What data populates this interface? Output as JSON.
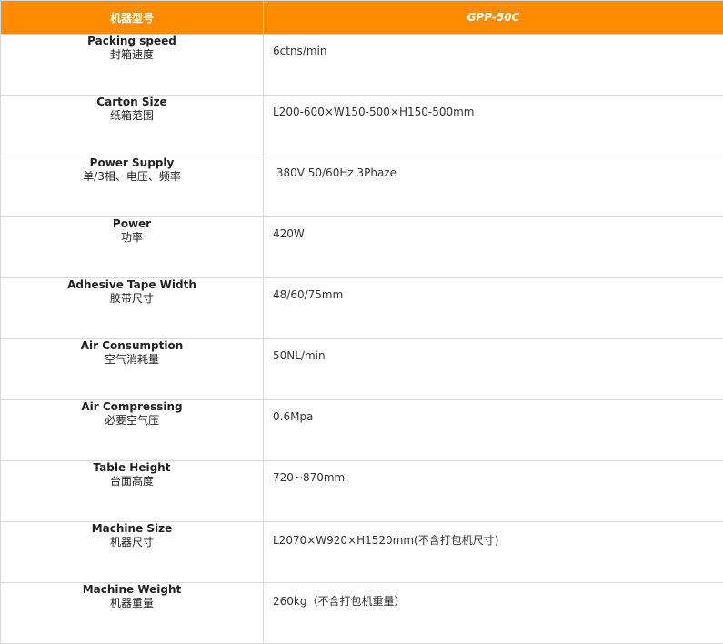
{
  "header": {
    "label_col": "机器型号",
    "model": "GPP-50C"
  },
  "rows": [
    {
      "en": "Packing speed",
      "zh": "封箱速度",
      "value": "6ctns/min"
    },
    {
      "en": "Carton Size",
      "zh": "纸箱范围",
      "value": "L200-600×W150-500×H150-500mm"
    },
    {
      "en": "Power Supply",
      "zh": "单/3相、电压、频率",
      "value": " 380V 50/60Hz 3Phaze"
    },
    {
      "en": "Power",
      "zh": "功率",
      "value": "420W"
    },
    {
      "en": "Adhesive Tape Width",
      "zh": "胶带尺寸",
      "value": "48/60/75mm"
    },
    {
      "en": "Air Consumption",
      "zh": "空气消耗量",
      "value": "50NL/min"
    },
    {
      "en": "Air Compressing",
      "zh": "必要空气压",
      "value": "0.6Mpa"
    },
    {
      "en": "Table Height",
      "zh": "台面高度",
      "value": "720~870mm"
    },
    {
      "en": "Machine Size",
      "zh": "机器尺寸",
      "value": "L2070×W920×H1520mm(不含打包机尺寸)"
    },
    {
      "en": "Machine Weight",
      "zh": "机器重量",
      "value": "260kg（不含打包机重量）"
    }
  ],
  "colors": {
    "header_bg": "#ff8c00",
    "header_text": "#ffffff",
    "border": "#d9d9d9"
  }
}
